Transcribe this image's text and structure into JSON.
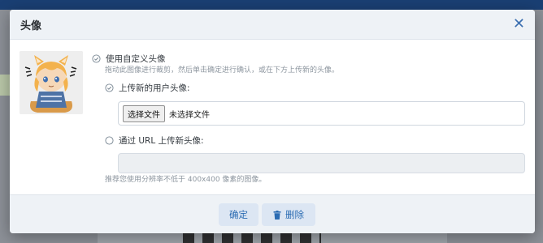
{
  "dialog": {
    "title": "头像",
    "close_glyph": "✕",
    "custom_option": {
      "label": "使用自定义头像",
      "hint": "拖动此图像进行裁剪，然后单击确定进行确认，或在下方上传新的头像。"
    },
    "upload_option": {
      "label": "上传新的用户头像:",
      "file_button": "选择文件",
      "file_status": "未选择文件"
    },
    "url_option": {
      "label": "通过 URL 上传新头像:",
      "value": ""
    },
    "resolution_hint": "推荐您使用分辨率不低于 400x400 像素的图像。",
    "buttons": {
      "confirm": "确定",
      "delete": "删除"
    },
    "icons": {
      "close": "close-icon",
      "check": "check-circle-icon",
      "radio": "radio-empty-icon",
      "trash": "trash-icon"
    }
  },
  "colors": {
    "accent": "#2b6cb3",
    "header_bg": "#eef2f6",
    "button_bg": "#dce6f3",
    "background_nav": "#1a3f73"
  }
}
